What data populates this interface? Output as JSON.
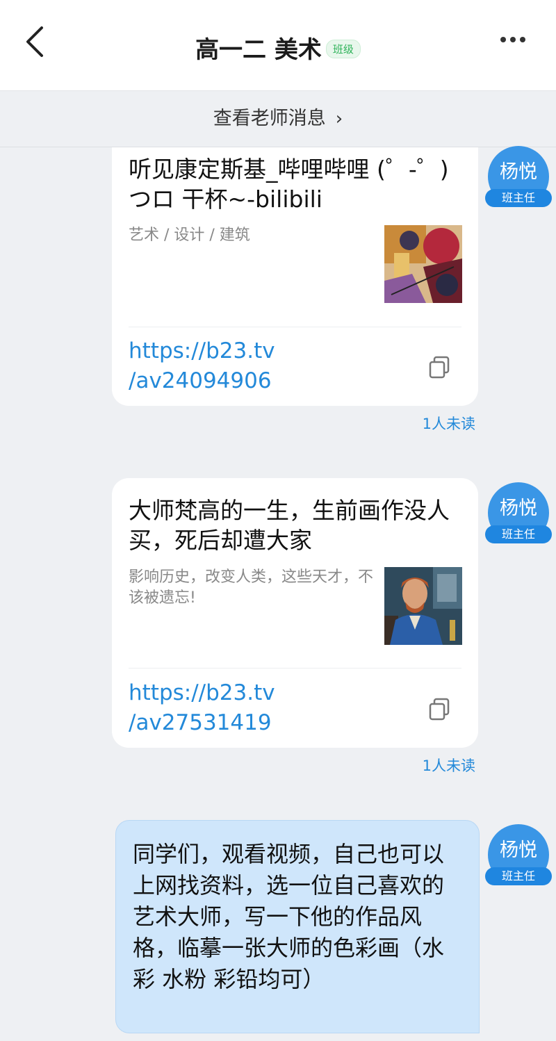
{
  "header": {
    "title": "高一二 美术",
    "badge": "班级"
  },
  "teacher_bar": {
    "label": "查看老师消息",
    "chevron": "›"
  },
  "messages": [
    {
      "type": "link_card",
      "title": "听见康定斯基_哔哩哔哩 (゜-゜)つロ 干杯~-bilibili",
      "description": "艺术 / 设计 / 建筑",
      "link_line1": "https://b23.tv",
      "link_line2": "/av24094906",
      "thumbnail_icon": "abstract-painting-thumbnail",
      "unread": "1人未读",
      "sender": {
        "name": "杨悦",
        "role": "班主任"
      }
    },
    {
      "type": "link_card",
      "title": "大师梵高的一生，生前画作没人买，死后却遭大家",
      "description": "影响历史，改变人类，这些天才，不该被遗忘!",
      "link_line1": "https://b23.tv",
      "link_line2": "/av27531419",
      "thumbnail_icon": "portrait-thumbnail",
      "unread": "1人未读",
      "sender": {
        "name": "杨悦",
        "role": "班主任"
      }
    },
    {
      "type": "text",
      "text": "同学们，观看视频，自己也可以上网找资料，选一位自己喜欢的艺术大师，写一下他的作品风格，临摹一张大师的色彩画（水彩 水粉 彩铅均可）",
      "sender": {
        "name": "杨悦",
        "role": "班主任"
      }
    }
  ],
  "colors": {
    "accent_blue": "#2389d9",
    "avatar_blue": "#3a96e6",
    "bubble_blue": "#cfe6fb",
    "badge_green": "#2fb35a",
    "background": "#eef0f3"
  }
}
